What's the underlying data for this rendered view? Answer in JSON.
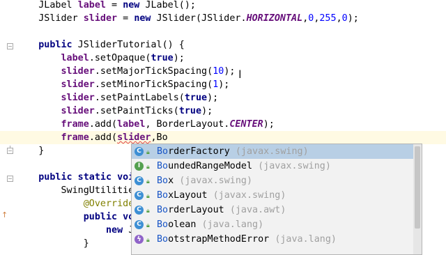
{
  "editor": {
    "lines": [
      {
        "indent": "    ",
        "parts": [
          [
            "t",
            "JLabel "
          ],
          [
            "fld",
            "label"
          ],
          [
            "t",
            " = "
          ],
          [
            "kw",
            "new"
          ],
          [
            "t",
            " JLabel();"
          ]
        ]
      },
      {
        "indent": "    ",
        "parts": [
          [
            "t",
            "JSlider "
          ],
          [
            "fld",
            "slider"
          ],
          [
            "t",
            " = "
          ],
          [
            "kw",
            "new"
          ],
          [
            "t",
            " JSlider(JSlider."
          ],
          [
            "sfld",
            "HORIZONTAL"
          ],
          [
            "t",
            ","
          ],
          [
            "num",
            "0"
          ],
          [
            "t",
            ","
          ],
          [
            "num",
            "255"
          ],
          [
            "t",
            ","
          ],
          [
            "num",
            "0"
          ],
          [
            "t",
            ");"
          ]
        ]
      },
      {
        "indent": "",
        "parts": []
      },
      {
        "indent": "    ",
        "parts": [
          [
            "kw",
            "public"
          ],
          [
            "t",
            " JSliderTutorial() {"
          ]
        ]
      },
      {
        "indent": "        ",
        "parts": [
          [
            "fld",
            "label"
          ],
          [
            "t",
            ".setOpaque("
          ],
          [
            "kw",
            "true"
          ],
          [
            "t",
            ");"
          ]
        ]
      },
      {
        "indent": "        ",
        "parts": [
          [
            "fld",
            "slider"
          ],
          [
            "t",
            ".setMajorTickSpacing("
          ],
          [
            "num",
            "10"
          ],
          [
            "t",
            ");"
          ]
        ]
      },
      {
        "indent": "        ",
        "parts": [
          [
            "fld",
            "slider"
          ],
          [
            "t",
            ".setMinorTickSpacing("
          ],
          [
            "num",
            "1"
          ],
          [
            "t",
            ");"
          ]
        ]
      },
      {
        "indent": "        ",
        "parts": [
          [
            "fld",
            "slider"
          ],
          [
            "t",
            ".setPaintLabels("
          ],
          [
            "kw",
            "true"
          ],
          [
            "t",
            ");"
          ]
        ]
      },
      {
        "indent": "        ",
        "parts": [
          [
            "fld",
            "slider"
          ],
          [
            "t",
            ".setPaintTicks("
          ],
          [
            "kw",
            "true"
          ],
          [
            "t",
            ");"
          ]
        ]
      },
      {
        "indent": "        ",
        "parts": [
          [
            "fld",
            "frame"
          ],
          [
            "t",
            ".add("
          ],
          [
            "fld",
            "label"
          ],
          [
            "t",
            ", BorderLayout."
          ],
          [
            "sfld",
            "CENTER"
          ],
          [
            "t",
            ");"
          ]
        ]
      },
      {
        "indent": "        ",
        "parts": [
          [
            "fld",
            "frame"
          ],
          [
            "t",
            ".add("
          ],
          [
            "err",
            "slider"
          ],
          [
            "t",
            ",Bo"
          ]
        ],
        "current": true
      },
      {
        "indent": "    ",
        "parts": [
          [
            "t",
            "}"
          ]
        ]
      },
      {
        "indent": "",
        "parts": []
      },
      {
        "indent": "    ",
        "parts": [
          [
            "kw",
            "public static voi"
          ]
        ]
      },
      {
        "indent": "        ",
        "parts": [
          [
            "t",
            "SwingUtilitie"
          ]
        ]
      },
      {
        "indent": "            ",
        "parts": [
          [
            "ann",
            "@Override"
          ]
        ]
      },
      {
        "indent": "            ",
        "parts": [
          [
            "kw",
            "public vo"
          ]
        ]
      },
      {
        "indent": "                ",
        "parts": [
          [
            "kw",
            "new"
          ],
          [
            "t",
            " J"
          ]
        ]
      },
      {
        "indent": "            ",
        "parts": [
          [
            "t",
            "}"
          ]
        ]
      }
    ]
  },
  "completion": {
    "typed_prefix": "Bo",
    "items": [
      {
        "icon": "c",
        "icon_name": "class-icon",
        "rest": "rderFactory",
        "pkg": "(javax.swing)",
        "selected": true
      },
      {
        "icon": "i",
        "icon_name": "interface-icon",
        "rest": "undedRangeModel",
        "pkg": "(javax.swing)"
      },
      {
        "icon": "c",
        "icon_name": "class-icon",
        "rest": "x",
        "pkg": "(javax.swing)"
      },
      {
        "icon": "c",
        "icon_name": "class-icon",
        "rest": "xLayout",
        "pkg": "(javax.swing)"
      },
      {
        "icon": "c",
        "icon_name": "class-icon",
        "rest": "rderLayout",
        "pkg": "(java.awt)"
      },
      {
        "icon": "c",
        "icon_name": "class-icon",
        "rest": "olean",
        "pkg": "(java.lang)"
      },
      {
        "icon": "e",
        "icon_name": "exception-icon",
        "rest": "otstrapMethodError",
        "pkg": "(java.lang)"
      }
    ]
  },
  "colors": {
    "keyword": "#000080",
    "field": "#660e7a",
    "number": "#0000ff",
    "selection": "#b8cfe5",
    "current_line": "#fffae3",
    "match": "#1a56c6"
  }
}
